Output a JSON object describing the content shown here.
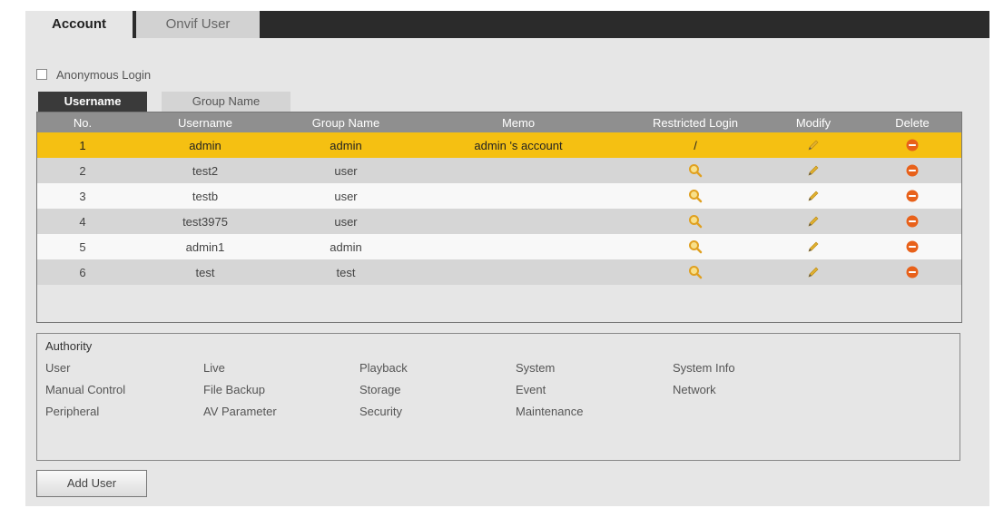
{
  "tabs": [
    {
      "label": "Account",
      "active": true
    },
    {
      "label": "Onvif User",
      "active": false
    }
  ],
  "anonymous_login": {
    "label": "Anonymous Login",
    "checked": false
  },
  "subtabs": [
    {
      "label": "Username",
      "active": true
    },
    {
      "label": "Group Name",
      "active": false
    }
  ],
  "table": {
    "headers": [
      "No.",
      "Username",
      "Group Name",
      "Memo",
      "Restricted Login",
      "Modify",
      "Delete"
    ],
    "rows": [
      {
        "no": "1",
        "username": "admin",
        "group": "admin",
        "memo": "admin 's account",
        "restricted": "/",
        "selected": true
      },
      {
        "no": "2",
        "username": "test2",
        "group": "user",
        "memo": "",
        "restricted": "search-icon"
      },
      {
        "no": "3",
        "username": "testb",
        "group": "user",
        "memo": "",
        "restricted": "search-icon"
      },
      {
        "no": "4",
        "username": "test3975",
        "group": "user",
        "memo": "",
        "restricted": "search-icon"
      },
      {
        "no": "5",
        "username": "admin1",
        "group": "admin",
        "memo": "",
        "restricted": "search-icon"
      },
      {
        "no": "6",
        "username": "test",
        "group": "test",
        "memo": "",
        "restricted": "search-icon"
      }
    ]
  },
  "authority": {
    "title": "Authority",
    "items": [
      [
        "User",
        "Live",
        "Playback",
        "System",
        "System Info"
      ],
      [
        "Manual Control",
        "File Backup",
        "Storage",
        "Event",
        "Network"
      ],
      [
        "Peripheral",
        "AV Parameter",
        "Security",
        "Maintenance"
      ]
    ]
  },
  "add_user_label": "Add User",
  "colors": {
    "selected_row": "#f5c012",
    "header_bg": "#8f8f8f",
    "topbar": "#2b2b2b",
    "delete_icon": "#e8611a",
    "edit_icon": "#d9a520"
  }
}
